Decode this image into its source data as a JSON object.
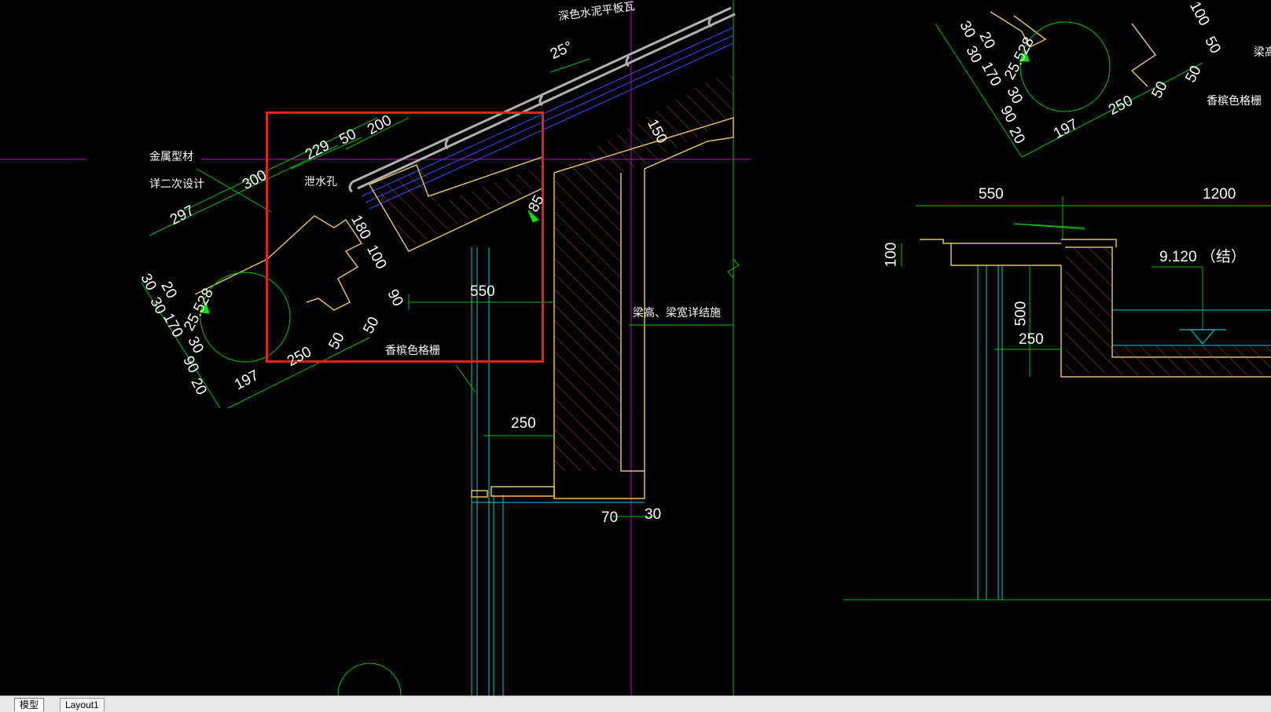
{
  "drawing": {
    "annotations": {
      "roof_tile": "深色水泥平板瓦",
      "slope": "25°",
      "metal_profile": "金属型材",
      "secondary_design": "详二次设计",
      "drain_hole": "泄水孔",
      "grille": "香槟色格栅",
      "beam_note": "梁高、梁宽详结施",
      "grille_right": "香槟色格栅",
      "beam_right": "梁高",
      "elevation": "9.120 （结）"
    },
    "dimensions": {
      "d300": "300",
      "d297": "297",
      "d229": "229",
      "d50a": "50",
      "d200": "200",
      "d180": "180",
      "d100": "100",
      "d90": "90",
      "d550": "550",
      "d85": "85",
      "d150": "150",
      "d30": "30",
      "d20": "20",
      "d30b": "30",
      "d170": "170",
      "d25528": "25.528",
      "d30c": "30",
      "d90b": "90",
      "d20b": "20",
      "d250": "250",
      "d50b": "50",
      "d50c": "50",
      "d197": "197",
      "d250b": "250",
      "d70": "70",
      "d30d": "30",
      "r550": "550",
      "r1200": "1200",
      "r100": "100",
      "r500": "500",
      "r250": "250",
      "tr30": "30",
      "tr20": "20",
      "tr30b": "30",
      "tr170": "170",
      "tr25528": "25.528",
      "tr30c": "30",
      "tr90": "90",
      "tr20b": "20",
      "tr250": "250",
      "tr50": "50",
      "tr50b": "50",
      "tr197": "197",
      "tr50c": "50",
      "tr100": "100"
    }
  },
  "highlight": {
    "color": "#e2231a"
  },
  "tabs": [
    {
      "label": "模型"
    },
    {
      "label": "Layout1"
    }
  ]
}
